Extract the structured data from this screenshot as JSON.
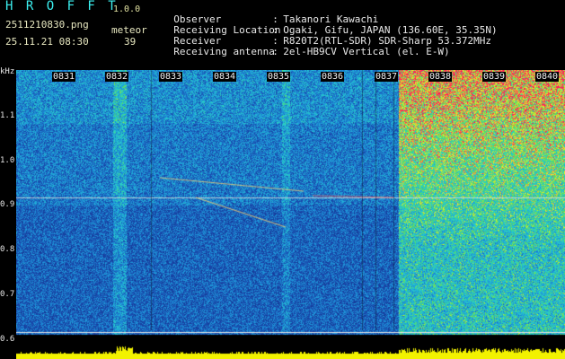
{
  "app": {
    "title": "H R O F F T",
    "version": "1.0.0"
  },
  "file_name": "2511210830.png",
  "datetime": "25.11.21 08:30",
  "meteor": {
    "label": "meteor",
    "count": "39"
  },
  "metadata": [
    {
      "key": "Observer",
      "sep": ":",
      "value": "Takanori Kawachi"
    },
    {
      "key": "Receiving Location",
      "sep": ":",
      "value": "Ogaki, Gifu, JAPAN (136.60E, 35.35N)"
    },
    {
      "key": "Receiver",
      "sep": ":",
      "value": "R820T2(RTL-SDR) SDR-Sharp 53.372MHz"
    },
    {
      "key": "Receiving antenna",
      "sep": ":",
      "value": "2el-HB9CV Vertical (el. E-W)"
    }
  ],
  "y_axis": {
    "unit": "kHz",
    "ticks": [
      "1.1",
      "1.0",
      "0.9",
      "0.8",
      "0.7",
      "0.6"
    ]
  },
  "time_axis": {
    "labels": [
      "0831",
      "0832",
      "0833",
      "0834",
      "0835",
      "0836",
      "0837",
      "0838",
      "0839",
      "0840"
    ]
  },
  "colors": {
    "background": "#000000",
    "spectrogram_base": "#1a3a8a",
    "noise_high": "#ff2060",
    "signal_bar": "#ffff00",
    "accent_text": "#3cf0f0"
  }
}
